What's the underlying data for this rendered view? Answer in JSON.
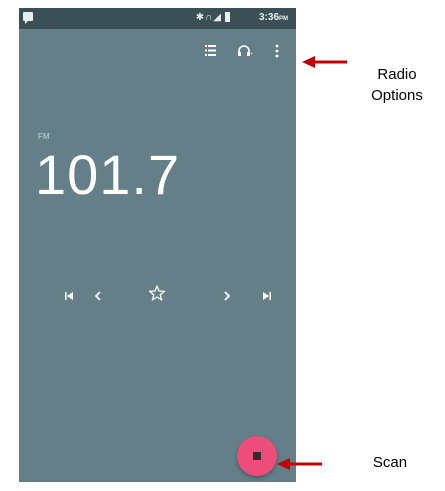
{
  "status_bar": {
    "time": "3:36",
    "ampm": "PM",
    "icons": [
      "bluetooth-icon",
      "headset-icon",
      "signal-icon",
      "battery-icon"
    ]
  },
  "toolbar": {
    "icons": [
      "station-list-icon",
      "headset-icon",
      "more-vert-icon"
    ]
  },
  "radio": {
    "band": "FM",
    "frequency": "101.7"
  },
  "controls": {
    "icons": [
      "skip-previous-icon",
      "chevron-left-icon",
      "star-outline-icon",
      "chevron-right-icon",
      "skip-next-icon"
    ]
  },
  "annotations": {
    "radio_options_line1": "Radio",
    "radio_options_line2": "Options",
    "scan": "Scan"
  },
  "colors": {
    "screen_bg": "#647f88",
    "status_bar_bg": "#3b4f56",
    "fab": "#ec4d7b",
    "arrow": "#c00000"
  }
}
